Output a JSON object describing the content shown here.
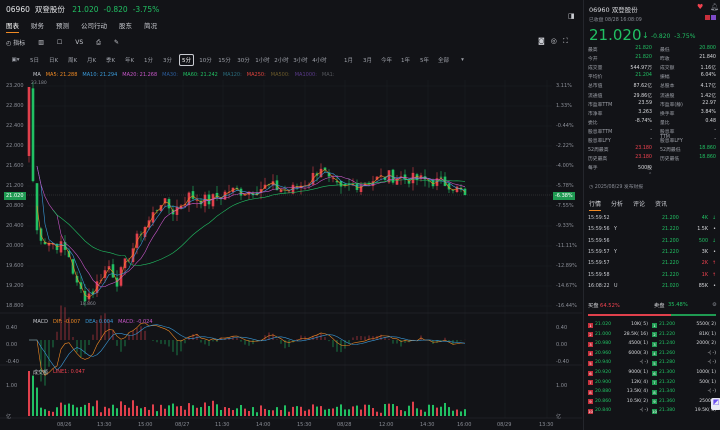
{
  "header": {
    "code": "06960",
    "name": "双登股份",
    "price": "21.020",
    "change": "-0.820",
    "pct": "-3.75%"
  },
  "tabs": [
    "图表",
    "财务",
    "预测",
    "公司行动",
    "股东",
    "简况"
  ],
  "tools": {
    "indicator": "指标",
    "vs": "VS"
  },
  "timeframes": [
    "5日",
    "日K",
    "周K",
    "月K",
    "季K",
    "年K",
    "1分",
    "3分",
    "5分",
    "10分",
    "15分",
    "30分",
    "1小时",
    "2小时",
    "3小时",
    "4小时",
    "1月",
    "3月",
    "今年",
    "1年",
    "5年",
    "全部"
  ],
  "selected_timeframe": "5分",
  "ma_legend": [
    {
      "t": "MA",
      "c": "#c9cbd1"
    },
    {
      "t": "MA5: 21.288",
      "c": "#f08a24"
    },
    {
      "t": "MA10: 21.294",
      "c": "#3a9ad9"
    },
    {
      "t": "MA20: 21.268",
      "c": "#c857c9"
    },
    {
      "t": "MA30:",
      "c": "#2b5d9c"
    },
    {
      "t": "MA60: 21.242",
      "c": "#21c063"
    },
    {
      "t": "MA120:",
      "c": "#2a6c7c"
    },
    {
      "t": "MA250:",
      "c": "#e0443e"
    },
    {
      "t": "MA500:",
      "c": "#6b5a2a"
    },
    {
      "t": "MA1000:",
      "c": "#5a3a8a"
    },
    {
      "t": "MA1:",
      "c": "#55575d"
    }
  ],
  "price_axis": [
    "23.200",
    "22.800",
    "22.400",
    "22.000",
    "21.600",
    "21.200",
    "20.800",
    "20.400",
    "20.000",
    "19.600",
    "19.200",
    "18.800"
  ],
  "pct_axis": [
    "3.11%",
    "1.33%",
    "-0.44%",
    "-2.22%",
    "-4.00%",
    "-5.78%",
    "-7.55%",
    "-9.33%",
    "-11.11%",
    "-12.89%",
    "-14.67%",
    "-16.44%"
  ],
  "current_price_tag": "21.020",
  "current_pct_tag": "-6.38%",
  "high_marker": "23.180",
  "low_marker": "18.860",
  "macd": {
    "label": "MACD",
    "dif": "DIF: -0.007",
    "dea": "DEA: 0.004",
    "macd": "MACD: -0.024",
    "axis": [
      "0.40",
      "0.00",
      "-0.40"
    ]
  },
  "volume": {
    "label": "成交额",
    "line": "LINE1: 0.047",
    "axis": [
      "1.00",
      "亿"
    ]
  },
  "x_axis": [
    "08/26",
    "13:30",
    "15:00",
    "08/27",
    "11:30",
    "14:00",
    "15:30",
    "08/28",
    "12:00",
    "14:30",
    "16:00",
    "08/29",
    "13:30"
  ],
  "chart_data": {
    "type": "candlestick",
    "ylim": [
      18.8,
      23.2
    ],
    "path_anchors": [
      [
        0,
        23.18
      ],
      [
        1,
        21.3
      ],
      [
        2,
        20.3
      ],
      [
        4,
        20.1
      ],
      [
        8,
        20.0
      ],
      [
        10,
        19.8
      ],
      [
        12,
        19.2
      ],
      [
        14,
        19.0
      ],
      [
        16,
        19.1
      ],
      [
        18,
        19.4
      ],
      [
        20,
        19.6
      ],
      [
        22,
        19.3
      ],
      [
        25,
        19.8
      ],
      [
        28,
        20.3
      ],
      [
        30,
        20.5
      ],
      [
        33,
        20.9
      ],
      [
        36,
        20.7
      ],
      [
        40,
        21.0
      ],
      [
        45,
        20.9
      ],
      [
        50,
        21.1
      ],
      [
        55,
        21.1
      ],
      [
        60,
        21.2
      ],
      [
        65,
        21.1
      ],
      [
        70,
        21.3
      ],
      [
        73,
        21.6
      ],
      [
        75,
        21.3
      ],
      [
        78,
        21.1
      ],
      [
        80,
        21.2
      ],
      [
        85,
        21.3
      ],
      [
        90,
        21.4
      ],
      [
        95,
        21.35
      ],
      [
        100,
        21.3
      ],
      [
        105,
        21.25
      ],
      [
        109,
        21.02
      ]
    ],
    "last": 21.02,
    "prev_close": 21.84
  },
  "quote": {
    "code": "06960",
    "name": "双登股份",
    "status": "已收盘 08/28 16:08:09",
    "price": "21.020",
    "arrow": "↓",
    "change": "-0.820",
    "pct": "-3.75%"
  },
  "stats": [
    [
      "最高",
      "21.820",
      "最低",
      "20.800"
    ],
    [
      "今开",
      "21.820",
      "昨收",
      "21.840"
    ],
    [
      "成交量",
      "544.97万",
      "成交额",
      "1.16亿"
    ],
    [
      "平均价",
      "21.204",
      "振幅",
      "6.04%"
    ],
    [
      "总市值",
      "87.62亿",
      "总股本",
      "4.17亿"
    ],
    [
      "流通值",
      "29.86亿",
      "流通股",
      "1.42亿"
    ],
    [
      "市盈率TTM",
      "23.59",
      "市盈率(静)",
      "22.97"
    ],
    [
      "市净率",
      "3.263",
      "换手率",
      "3.84%"
    ],
    [
      "委比",
      "-8.74%",
      "量比",
      "0.48"
    ],
    [
      "股息率TTM",
      "-",
      "股息率TTM",
      "-"
    ],
    [
      "股息率LFY",
      "-",
      "股息率LFY",
      "-"
    ],
    [
      "52周最高",
      "23.180",
      "52周最低",
      "18.860"
    ],
    [
      "历史最高",
      "23.180",
      "历史最低",
      "18.860"
    ],
    [
      "每手",
      "500股",
      "",
      ""
    ]
  ],
  "earnings_date": "2025/08/29 发布财报",
  "detail_tabs": [
    "行情",
    "分析",
    "评论",
    "资讯"
  ],
  "trades": [
    [
      "15:59:52",
      "",
      "21.200",
      "4K",
      "g"
    ],
    [
      "15:59:56",
      "Y",
      "21.220",
      "1.5K",
      "w"
    ],
    [
      "15:59:56",
      "",
      "21.200",
      "500",
      "g"
    ],
    [
      "15:59:57",
      "Y",
      "21.220",
      "3K",
      "w"
    ],
    [
      "15:59:57",
      "",
      "21.220",
      "2K",
      "r"
    ],
    [
      "15:59:58",
      "",
      "21.220",
      "1K",
      "r"
    ],
    [
      "16:08:22",
      "U",
      "21.020",
      "85K",
      "w"
    ]
  ],
  "ratio": {
    "buy_label": "买盘",
    "buy": "64.52%",
    "sell_label": "卖盘",
    "sell": "35.48%",
    "buy_fraction": 0.6452
  },
  "bids": [
    [
      "1",
      "21.020",
      "10K(  5)"
    ],
    [
      "2",
      "21.000",
      "28.5K( 16)"
    ],
    [
      "3",
      "20.980",
      "4500(  1)"
    ],
    [
      "4",
      "20.960",
      "6000(  3)"
    ],
    [
      "5",
      "20.940",
      "-(  -)"
    ],
    [
      "6",
      "20.920",
      "9000(  1)"
    ],
    [
      "7",
      "20.900",
      "12K(  4)"
    ],
    [
      "8",
      "20.880",
      "13.5K(  4)"
    ],
    [
      "9",
      "20.860",
      "10.5K(  2)"
    ],
    [
      "10",
      "20.840",
      "-(  -)"
    ]
  ],
  "asks": [
    [
      "1",
      "21.200",
      "5500(  2)"
    ],
    [
      "2",
      "21.220",
      "81K(  1)"
    ],
    [
      "3",
      "21.240",
      "2000(  2)"
    ],
    [
      "4",
      "21.260",
      "-(  -)"
    ],
    [
      "5",
      "21.280",
      "-(  -)"
    ],
    [
      "6",
      "21.300",
      "1000(  1)"
    ],
    [
      "7",
      "21.320",
      "500(  1)"
    ],
    [
      "8",
      "21.340",
      "-(  -)"
    ],
    [
      "9",
      "21.360",
      "2500(  )"
    ],
    [
      "10",
      "21.380",
      "19.5K(  3)"
    ]
  ]
}
